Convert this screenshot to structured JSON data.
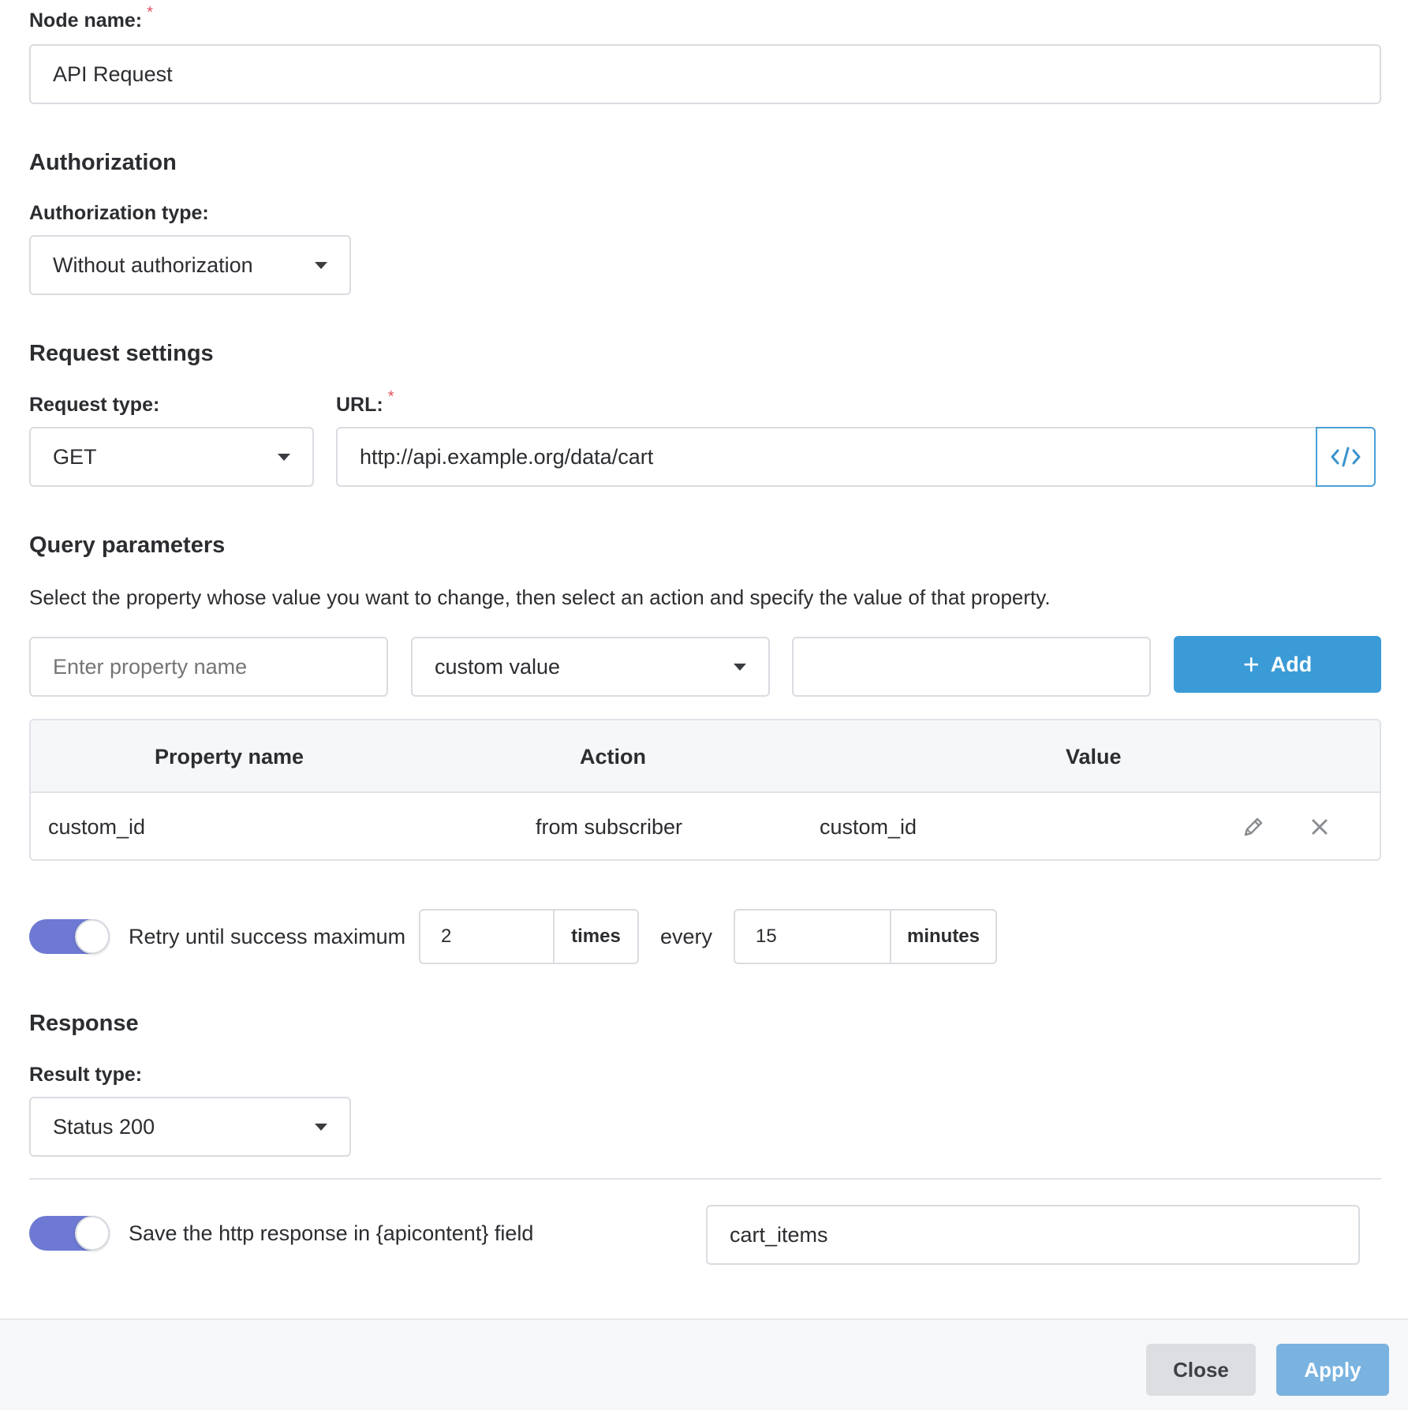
{
  "node": {
    "label": "Node name:",
    "required_mark": "*",
    "value": "API Request"
  },
  "authorization": {
    "title": "Authorization",
    "type_label": "Authorization type:",
    "type_value": "Without authorization"
  },
  "request": {
    "title": "Request settings",
    "type_label": "Request type:",
    "type_value": "GET",
    "url_label": "URL:",
    "url_required_mark": "*",
    "url_value": "http://api.example.org/data/cart",
    "code_icon": "code-icon"
  },
  "query": {
    "title": "Query parameters",
    "description": "Select the property whose value you want to change, then select an action and specify the value of that property.",
    "property_placeholder": "Enter property name",
    "action_value": "custom value",
    "value_input": "",
    "add_label": "Add",
    "add_icon": "+",
    "table": {
      "headers": [
        "Property name",
        "Action",
        "Value"
      ],
      "rows": [
        {
          "property": "custom_id",
          "action": "from subscriber",
          "value": "custom_id"
        }
      ]
    }
  },
  "retry": {
    "enabled": true,
    "label": "Retry until success maximum",
    "times_value": "2",
    "times_unit": "times",
    "every_label": "every",
    "interval_value": "15",
    "interval_unit": "minutes"
  },
  "response": {
    "title": "Response",
    "result_label": "Result type:",
    "result_value": "Status 200",
    "save_enabled": true,
    "save_label": "Save the http response in {apicontent} field",
    "save_field_value": "cart_items"
  },
  "footer": {
    "close_label": "Close",
    "apply_label": "Apply"
  },
  "colors": {
    "accent": "#3a9bd6",
    "toggle": "#6d79d2",
    "apply": "#7ab3df",
    "required": "#e0525e"
  }
}
